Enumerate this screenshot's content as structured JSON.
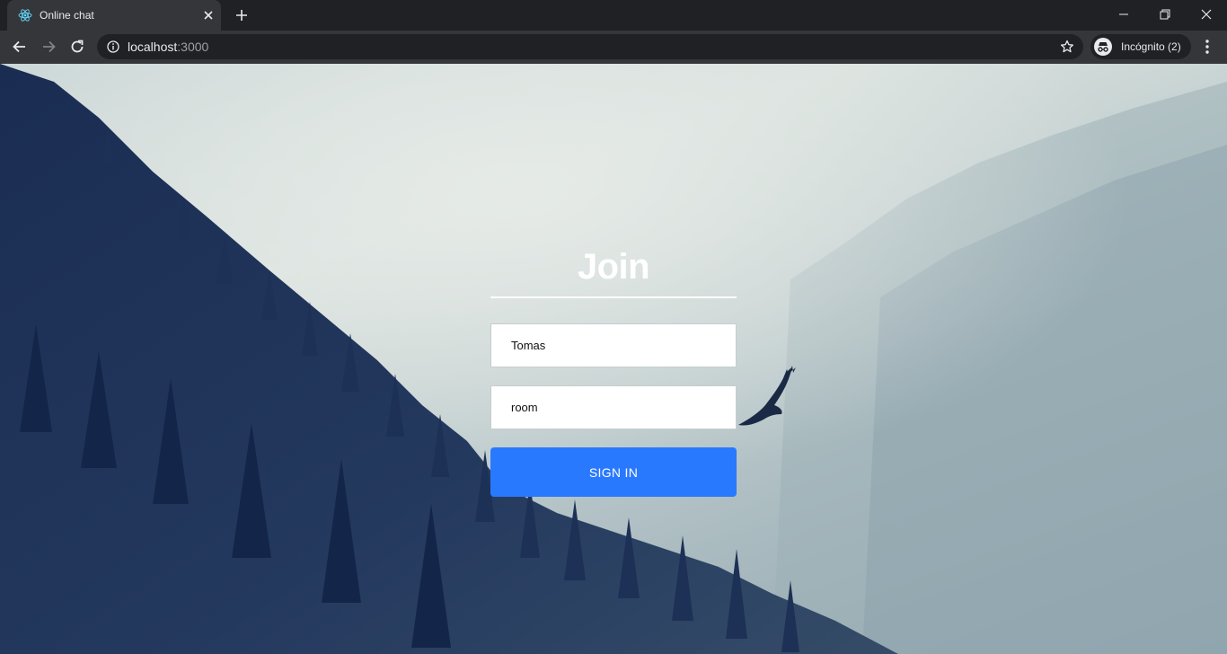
{
  "browser": {
    "tab": {
      "title": "Online chat",
      "favicon": "react-atom-icon"
    },
    "address": {
      "host": "localhost",
      "port": ":3000"
    },
    "profile": {
      "label": "Incógnito (2)"
    }
  },
  "join": {
    "title": "Join",
    "name_value": "Tomas",
    "room_value": "room",
    "button_label": "SIGN IN"
  },
  "colors": {
    "accent": "#2979ff",
    "chrome_dark": "#202124",
    "chrome_toolbar": "#35363a",
    "title_text": "#ffffff"
  }
}
